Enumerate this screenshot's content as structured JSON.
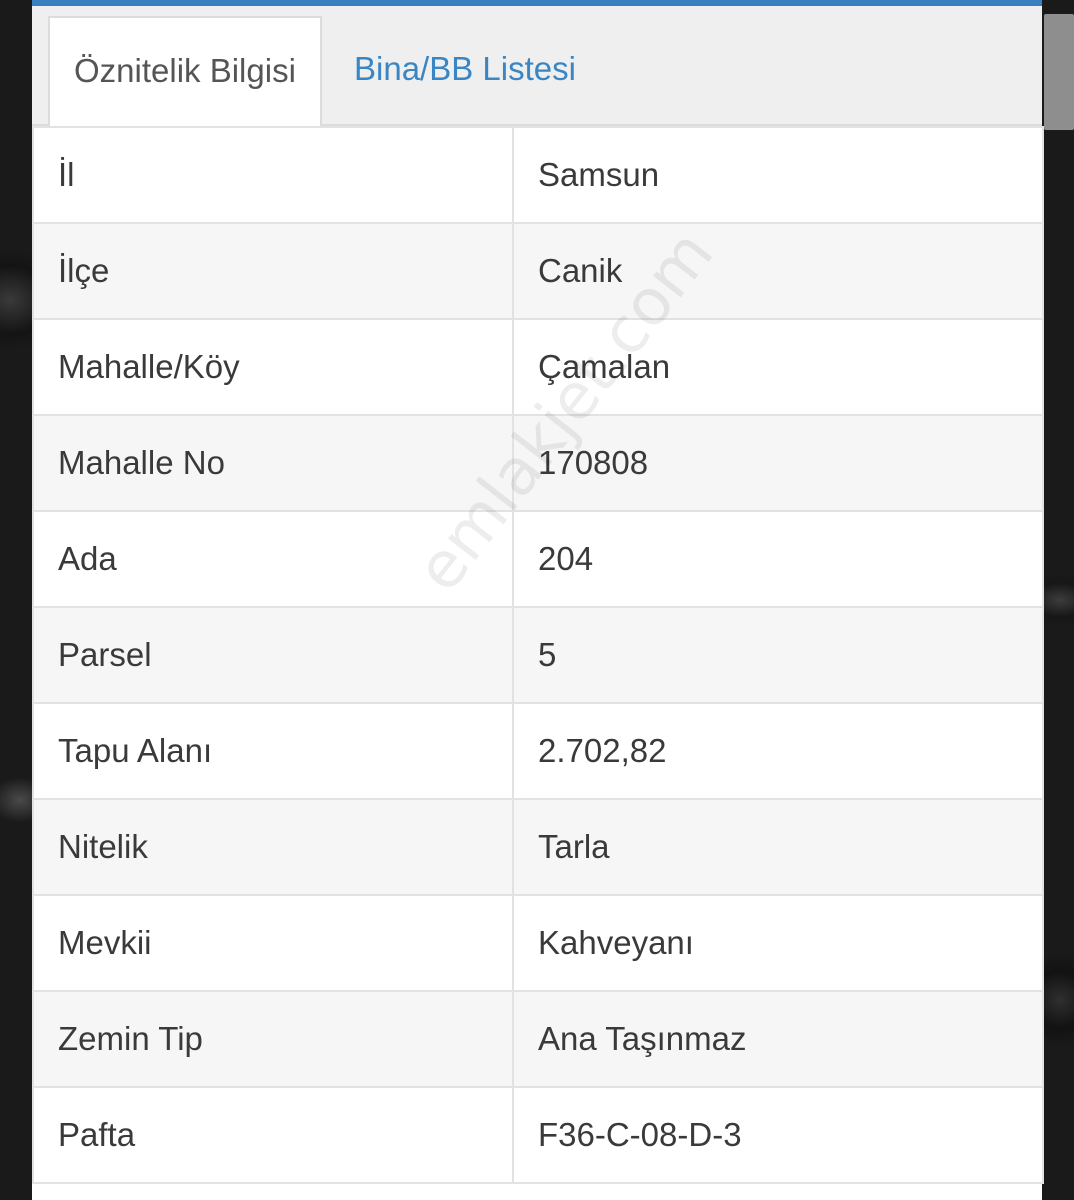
{
  "tabs": [
    {
      "label": "Öznitelik Bilgisi",
      "active": true
    },
    {
      "label": "Bina/BB Listesi",
      "active": false
    }
  ],
  "rows": [
    {
      "label": "İl",
      "value": "Samsun"
    },
    {
      "label": "İlçe",
      "value": "Canik"
    },
    {
      "label": "Mahalle/Köy",
      "value": "Çamalan"
    },
    {
      "label": "Mahalle No",
      "value": "170808"
    },
    {
      "label": "Ada",
      "value": "204"
    },
    {
      "label": "Parsel",
      "value": "5"
    },
    {
      "label": "Tapu Alanı",
      "value": "2.702,82"
    },
    {
      "label": "Nitelik",
      "value": "Tarla"
    },
    {
      "label": "Mevkii",
      "value": "Kahveyanı"
    },
    {
      "label": "Zemin Tip",
      "value": "Ana Taşınmaz"
    },
    {
      "label": "Pafta",
      "value": "F36-C-08-D-3"
    }
  ],
  "watermark": "emlakjet.com",
  "colors": {
    "accent": "#3a80c0",
    "tab_link": "#3a86c4",
    "text": "#3a3a3a"
  }
}
